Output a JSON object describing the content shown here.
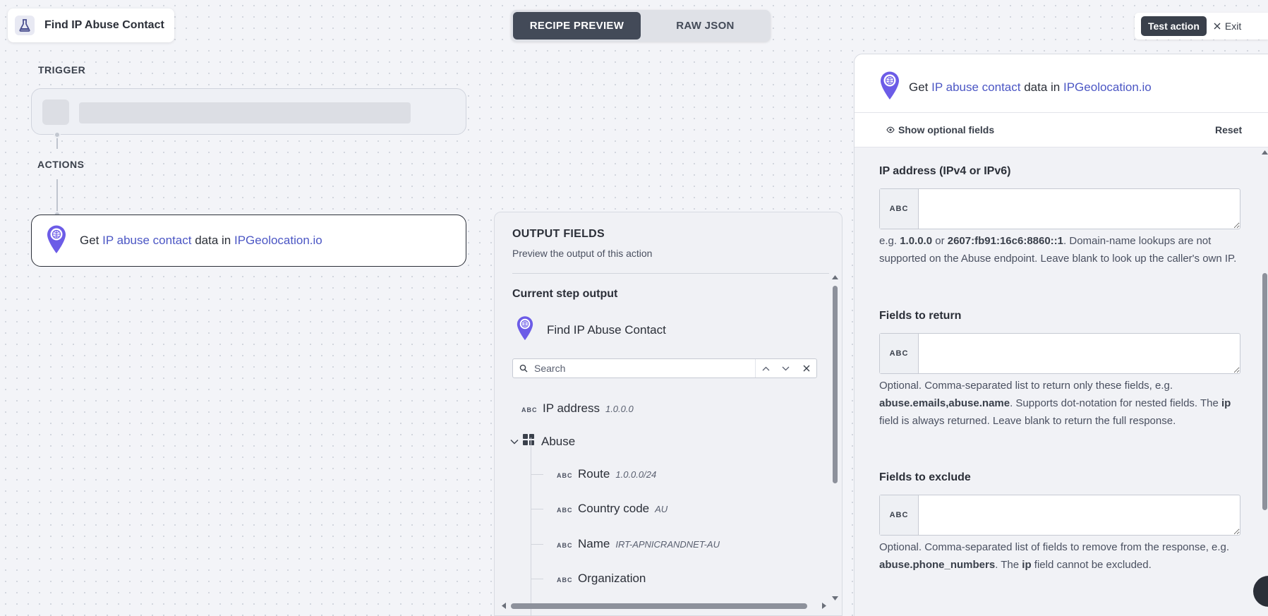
{
  "app": {
    "title": "Find IP Abuse Contact",
    "view_toggle": {
      "active": "RECIPE PREVIEW",
      "inactive": "RAW JSON"
    },
    "test_action": "Test action",
    "exit": "Exit"
  },
  "canvas": {
    "trigger_label": "TRIGGER",
    "actions_label": "ACTIONS",
    "action": {
      "prefix": "Get",
      "object": "IP abuse contact",
      "middle": "data in",
      "app": "IPGeolocation.io"
    }
  },
  "output": {
    "title": "OUTPUT FIELDS",
    "subtitle": "Preview the output of this action",
    "current_step": "Current step output",
    "step_name": "Find IP Abuse Contact",
    "search_placeholder": "Search",
    "type_tag": "ABC",
    "ip_field": {
      "name": "IP address",
      "value": "1.0.0.0"
    },
    "group": {
      "name": "Abuse"
    },
    "children": [
      {
        "name": "Route",
        "value": "1.0.0.0/24"
      },
      {
        "name": "Country code",
        "value": "AU"
      },
      {
        "name": "Name",
        "value": "IRT-APNICRANDNET-AU"
      },
      {
        "name": "Organization",
        "value": ""
      }
    ]
  },
  "config": {
    "header": {
      "prefix": "Get",
      "object": "IP abuse contact",
      "middle": "data in",
      "app": "IPGeolocation.io"
    },
    "show_optional": "Show optional fields",
    "reset": "Reset",
    "type_tag": "ABC",
    "fields": [
      {
        "label": "IP address (IPv4 or IPv6)",
        "hint_parts": [
          {
            "t": "e.g. ",
            "b": false
          },
          {
            "t": "1.0.0.0",
            "b": true
          },
          {
            "t": " or ",
            "b": false
          },
          {
            "t": "2607:fb91:16c6:8860::1",
            "b": true
          },
          {
            "t": ". Domain-name lookups are not supported on the Abuse endpoint. Leave blank to look up the caller's own IP.",
            "b": false
          }
        ]
      },
      {
        "label": "Fields to return",
        "hint_parts": [
          {
            "t": "Optional. Comma-separated list to return only these fields, e.g. ",
            "b": false
          },
          {
            "t": "abuse.emails,abuse.name",
            "b": true
          },
          {
            "t": ". Supports dot-notation for nested fields. The ",
            "b": false
          },
          {
            "t": "ip",
            "b": true
          },
          {
            "t": " field is always returned. Leave blank to return the full response.",
            "b": false
          }
        ]
      },
      {
        "label": "Fields to exclude",
        "hint_parts": [
          {
            "t": "Optional. Comma-separated list of fields to remove from the response, e.g. ",
            "b": false
          },
          {
            "t": "abuse.phone_numbers",
            "b": true
          },
          {
            "t": ". The ",
            "b": false
          },
          {
            "t": "ip",
            "b": true
          },
          {
            "t": " field cannot be excluded.",
            "b": false
          }
        ]
      }
    ]
  },
  "colors": {
    "accent": "#6c5ce7",
    "link": "#4b56c4",
    "dark_button": "#434a58"
  }
}
